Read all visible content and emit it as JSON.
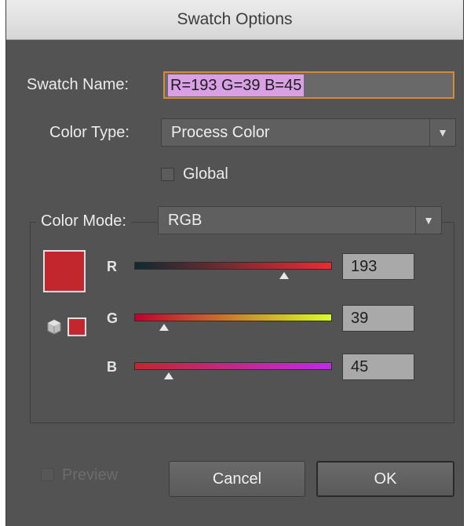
{
  "window": {
    "title": "Swatch Options"
  },
  "swatch_name": {
    "label": "Swatch Name:",
    "value": "R=193 G=39 B=45"
  },
  "color_type": {
    "label": "Color Type:",
    "value": "Process Color"
  },
  "global": {
    "label": "Global",
    "checked": false
  },
  "color_mode": {
    "label": "Color Mode:",
    "value": "RGB"
  },
  "channels": [
    {
      "label": "R",
      "value": "193",
      "level": 193
    },
    {
      "label": "G",
      "value": "39",
      "level": 39
    },
    {
      "label": "B",
      "value": "45",
      "level": 45
    }
  ],
  "swatch_color": "#c1272d",
  "preview": {
    "label": "Preview",
    "checked": false,
    "enabled": false
  },
  "buttons": {
    "cancel": "Cancel",
    "ok": "OK"
  },
  "icons": {
    "gamut_icon": "cube-icon",
    "dropdown_icon": "chevron-down-icon"
  }
}
